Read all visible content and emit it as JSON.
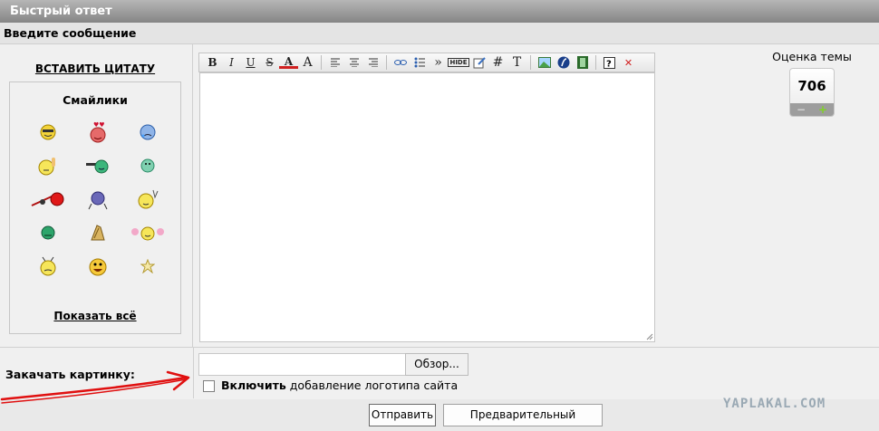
{
  "header": {
    "title": "Быстрый ответ"
  },
  "subheader": {
    "title": "Введите сообщение"
  },
  "left": {
    "quote_link": "ВСТАВИТЬ ЦИТАТУ",
    "smilies_title": "Смайлики",
    "show_all": "Показать всё",
    "smilies": [
      "cool-smiley",
      "love-smiley",
      "crying-smiley",
      "thinking-smiley",
      "gun-smiley",
      "grin-smiley",
      "fighting-smiley",
      "dancing-smiley",
      "victory-smiley",
      "sad-smiley",
      "clapping-hands",
      "cheerleader-smiley",
      "alien-smiley",
      "laughing-smiley",
      "star"
    ]
  },
  "toolbar": {
    "buttons": [
      "B",
      "I",
      "U",
      "S",
      "A",
      "A",
      "#",
      "T"
    ],
    "hide_label": "HIDE"
  },
  "rating": {
    "label": "Оценка темы",
    "value": "706",
    "minus": "−",
    "plus": "+"
  },
  "upload": {
    "label": "Закачать картинку:",
    "browse": "Обзор...",
    "checkbox_bold": "Включить",
    "checkbox_rest": " добавление логотипа сайта"
  },
  "buttons": {
    "send": "Отправить",
    "preview": "Предварительный просмотр"
  },
  "watermark": "YAPLAKAL.COM",
  "colors": {
    "header_top": "#b6b6b6",
    "header_bottom": "#858585",
    "arrow": "#e01010"
  }
}
